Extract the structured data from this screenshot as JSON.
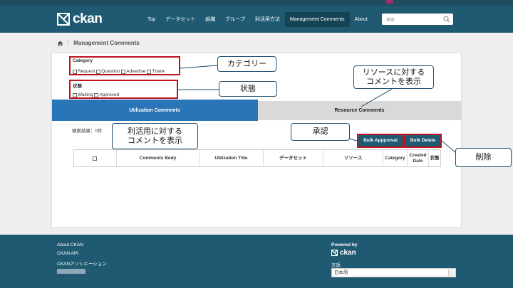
{
  "header": {
    "logo_text": "ckan",
    "nav": [
      "Top",
      "データセット",
      "組織",
      "グループ",
      "利活用方法",
      "Management Comments",
      "About"
    ],
    "active_nav_index": 5,
    "search_placeholder": "検索"
  },
  "breadcrumb": {
    "current": "Management Comments"
  },
  "filters": {
    "category_label": "Category",
    "category_options": [
      "Request",
      "Question",
      "Advertise",
      "Thank"
    ],
    "status_label": "状態",
    "status_options": [
      "Waiting",
      "Approved"
    ]
  },
  "tabs": {
    "utilization": "Utilization Commnets",
    "resource": "Resource Comments"
  },
  "result_label": "検索結果：0件",
  "buttons": {
    "bulk_approval": "Bulk Appproval",
    "bulk_delete": "Bulk Delete"
  },
  "table": {
    "headers": [
      "",
      "Comments Body",
      "Utilization Title",
      "データセット",
      "リソース",
      "Category",
      "Created Date",
      "状態"
    ]
  },
  "annotations": {
    "category": "カテゴリー",
    "status": "状態",
    "resource": "リソースに対する\nコメントを表示",
    "utilization": "利活用に対する\nコメントを表示",
    "approve": "承認",
    "delete": "削除"
  },
  "footer": {
    "links": [
      "About CKAN",
      "CKAN API",
      "CKANアソシエーション"
    ],
    "powered_by": "Powered by",
    "logo_text": "ckan",
    "language_label": "言語",
    "language_value": "日本語"
  },
  "colors": {
    "header": "#1f5a72",
    "tab_active": "#2a74b8",
    "highlight": "#c0131f"
  }
}
